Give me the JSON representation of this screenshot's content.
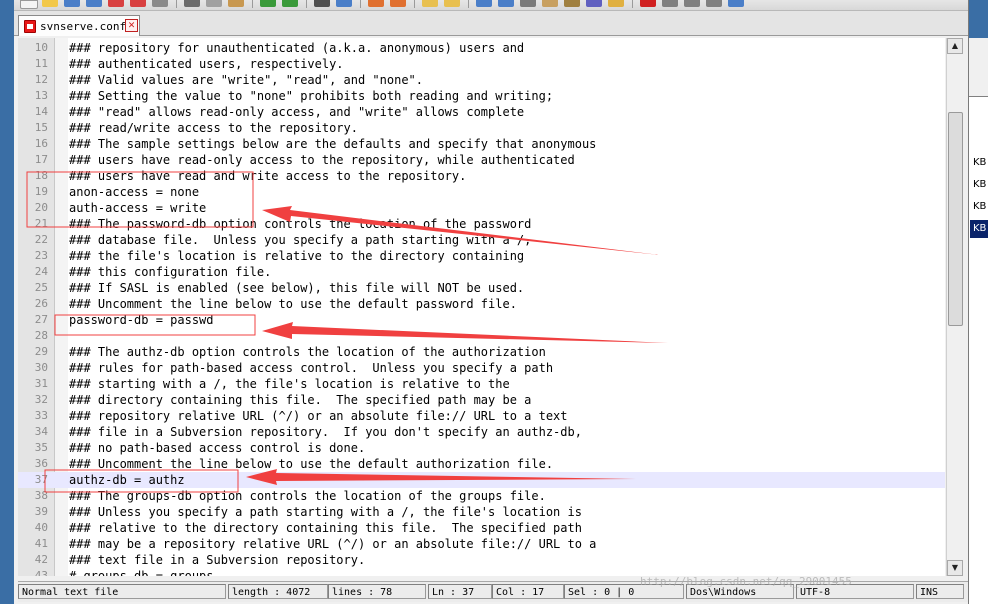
{
  "tab": {
    "label": "svnserve.conf",
    "close_symbol": "✕"
  },
  "editor": {
    "lines": [
      {
        "n": "10",
        "text": "### repository for unauthenticated (a.k.a. anonymous) users and"
      },
      {
        "n": "11",
        "text": "### authenticated users, respectively."
      },
      {
        "n": "12",
        "text": "### Valid values are \"write\", \"read\", and \"none\"."
      },
      {
        "n": "13",
        "text": "### Setting the value to \"none\" prohibits both reading and writing;"
      },
      {
        "n": "14",
        "text": "### \"read\" allows read-only access, and \"write\" allows complete"
      },
      {
        "n": "15",
        "text": "### read/write access to the repository."
      },
      {
        "n": "16",
        "text": "### The sample settings below are the defaults and specify that anonymous"
      },
      {
        "n": "17",
        "text": "### users have read-only access to the repository, while authenticated"
      },
      {
        "n": "18",
        "text": "### users have read and write access to the repository."
      },
      {
        "n": "19",
        "text": "anon-access = none"
      },
      {
        "n": "20",
        "text": "auth-access = write"
      },
      {
        "n": "21",
        "text": "### The password-db option controls the location of the password"
      },
      {
        "n": "22",
        "text": "### database file.  Unless you specify a path starting with a /,"
      },
      {
        "n": "23",
        "text": "### the file's location is relative to the directory containing"
      },
      {
        "n": "24",
        "text": "### this configuration file."
      },
      {
        "n": "25",
        "text": "### If SASL is enabled (see below), this file will NOT be used."
      },
      {
        "n": "26",
        "text": "### Uncomment the line below to use the default password file."
      },
      {
        "n": "27",
        "text": "password-db = passwd"
      },
      {
        "n": "28",
        "text": ""
      },
      {
        "n": "29",
        "text": "### The authz-db option controls the location of the authorization"
      },
      {
        "n": "30",
        "text": "### rules for path-based access control.  Unless you specify a path"
      },
      {
        "n": "31",
        "text": "### starting with a /, the file's location is relative to the"
      },
      {
        "n": "32",
        "text": "### directory containing this file.  The specified path may be a"
      },
      {
        "n": "33",
        "text": "### repository relative URL (^/) or an absolute file:// URL to a text"
      },
      {
        "n": "34",
        "text": "### file in a Subversion repository.  If you don't specify an authz-db,"
      },
      {
        "n": "35",
        "text": "### no path-based access control is done."
      },
      {
        "n": "36",
        "text": "### Uncomment the line below to use the default authorization file."
      },
      {
        "n": "37",
        "text": "authz-db = authz"
      },
      {
        "n": "38",
        "text": "### The groups-db option controls the location of the groups file."
      },
      {
        "n": "39",
        "text": "### Unless you specify a path starting with a /, the file's location is"
      },
      {
        "n": "40",
        "text": "### relative to the directory containing this file.  The specified path"
      },
      {
        "n": "41",
        "text": "### may be a repository relative URL (^/) or an absolute file:// URL to a"
      },
      {
        "n": "42",
        "text": "### text file in a Subversion repository."
      },
      {
        "n": "43",
        "text": "# groups-db = groups"
      }
    ],
    "current_line": "37"
  },
  "scrollbar": {
    "up_symbol": "▲",
    "down_symbol": "▼"
  },
  "statusbar": {
    "file_type": "Normal text file",
    "length": "length : 4072",
    "lines": "lines : 78",
    "ln": "Ln : 37",
    "col": "Col : 17",
    "sel": "Sel : 0 | 0",
    "eol": "Dos\\Windows",
    "encoding": "UTF-8",
    "mode": "INS"
  },
  "watermark": "http://blog.csdn.net/qq_29001455",
  "side_panel": {
    "items": [
      "KB",
      "KB",
      "KB",
      "KB"
    ]
  },
  "colors": {
    "annotation": "#f04040",
    "current_line": "#e8e8ff",
    "selection": "#0a246a"
  }
}
